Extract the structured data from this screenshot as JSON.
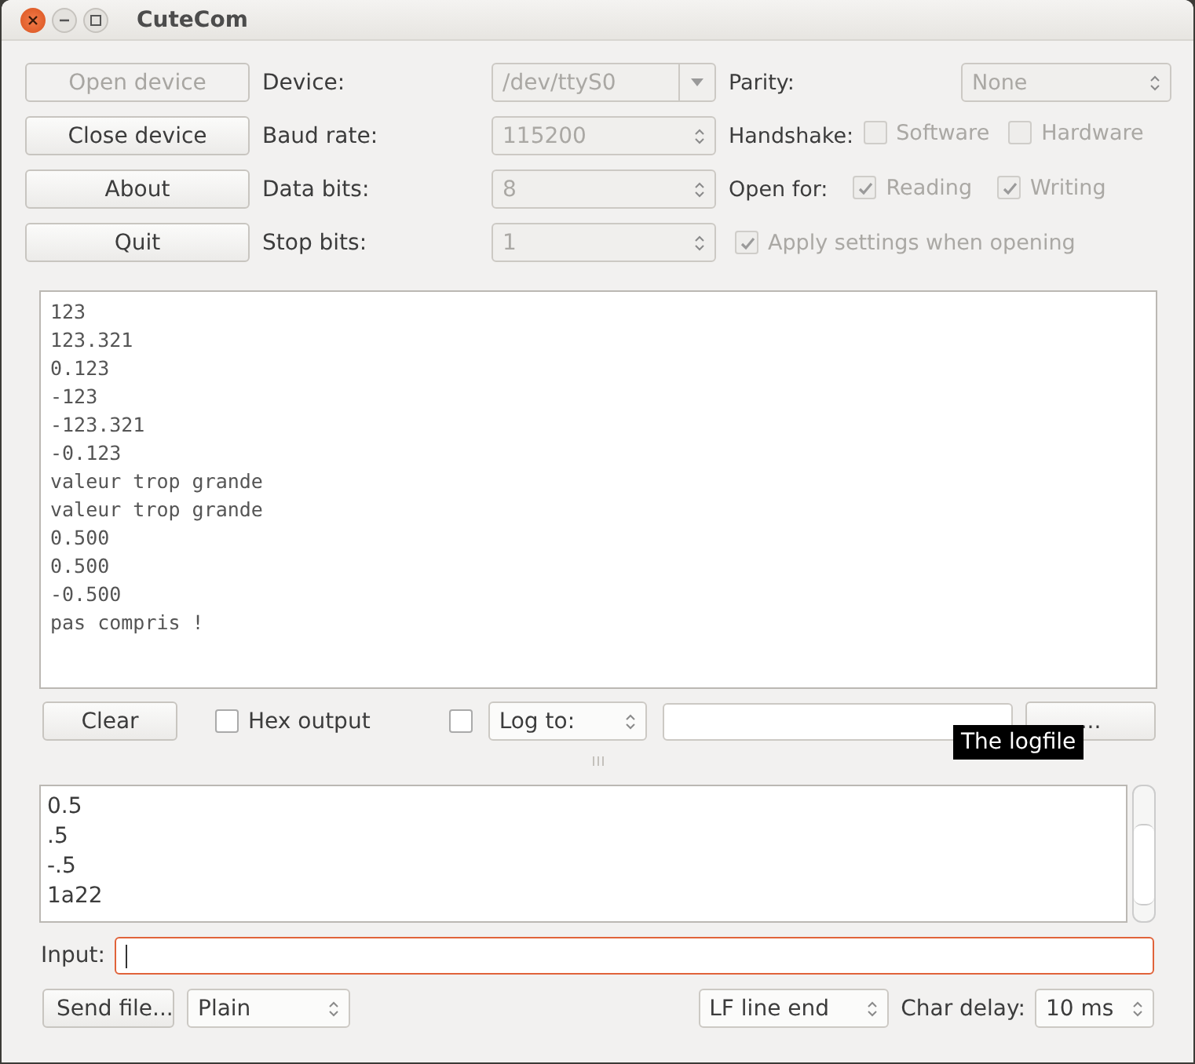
{
  "window": {
    "title": "CuteCom"
  },
  "buttons": [
    {
      "label": "Open device",
      "disabled": true
    },
    {
      "label": "Close device",
      "disabled": false
    },
    {
      "label": "About",
      "disabled": false
    },
    {
      "label": "Quit",
      "disabled": false
    }
  ],
  "settings": [
    {
      "label": "Device:",
      "value": "/dev/ttyS0",
      "kind": "dropdown",
      "disabled": true
    },
    {
      "label": "Baud rate:",
      "value": "115200",
      "kind": "spin",
      "disabled": true
    },
    {
      "label": "Data bits:",
      "value": "8",
      "kind": "spin",
      "disabled": true
    },
    {
      "label": "Stop bits:",
      "value": "1",
      "kind": "spin",
      "disabled": true
    }
  ],
  "parity": {
    "label": "Parity:",
    "value": "None",
    "disabled": true
  },
  "handshake": {
    "label": "Handshake:",
    "options": [
      {
        "label": "Software",
        "checked": false,
        "disabled": true
      },
      {
        "label": "Hardware",
        "checked": false,
        "disabled": true
      }
    ]
  },
  "open_for": {
    "label": "Open for:",
    "options": [
      {
        "label": "Reading",
        "checked": true,
        "disabled": true
      },
      {
        "label": "Writing",
        "checked": true,
        "disabled": true
      }
    ]
  },
  "apply_settings": {
    "label": "Apply settings when opening",
    "checked": true,
    "disabled": true
  },
  "output_lines": [
    "123",
    "123.321",
    "0.123",
    "-123",
    "-123.321",
    "-0.123",
    "valeur trop grande",
    "valeur trop grande",
    "0.500",
    "0.500",
    "-0.500",
    "pas compris !"
  ],
  "clear_button": "Clear",
  "hex_output": {
    "label": "Hex output",
    "checked": false,
    "disabled": false
  },
  "log": {
    "checked": false,
    "mode": "Log to:",
    "browse_button": "...",
    "tooltip": "The logfile"
  },
  "history": [
    "0.5",
    ".5",
    "-.5",
    "1a22"
  ],
  "input": {
    "label": "Input:"
  },
  "send_file_button": "Send file...",
  "format": "Plain",
  "line_end": "LF line end",
  "char_delay": {
    "label": "Char delay:",
    "value": "10 ms"
  }
}
